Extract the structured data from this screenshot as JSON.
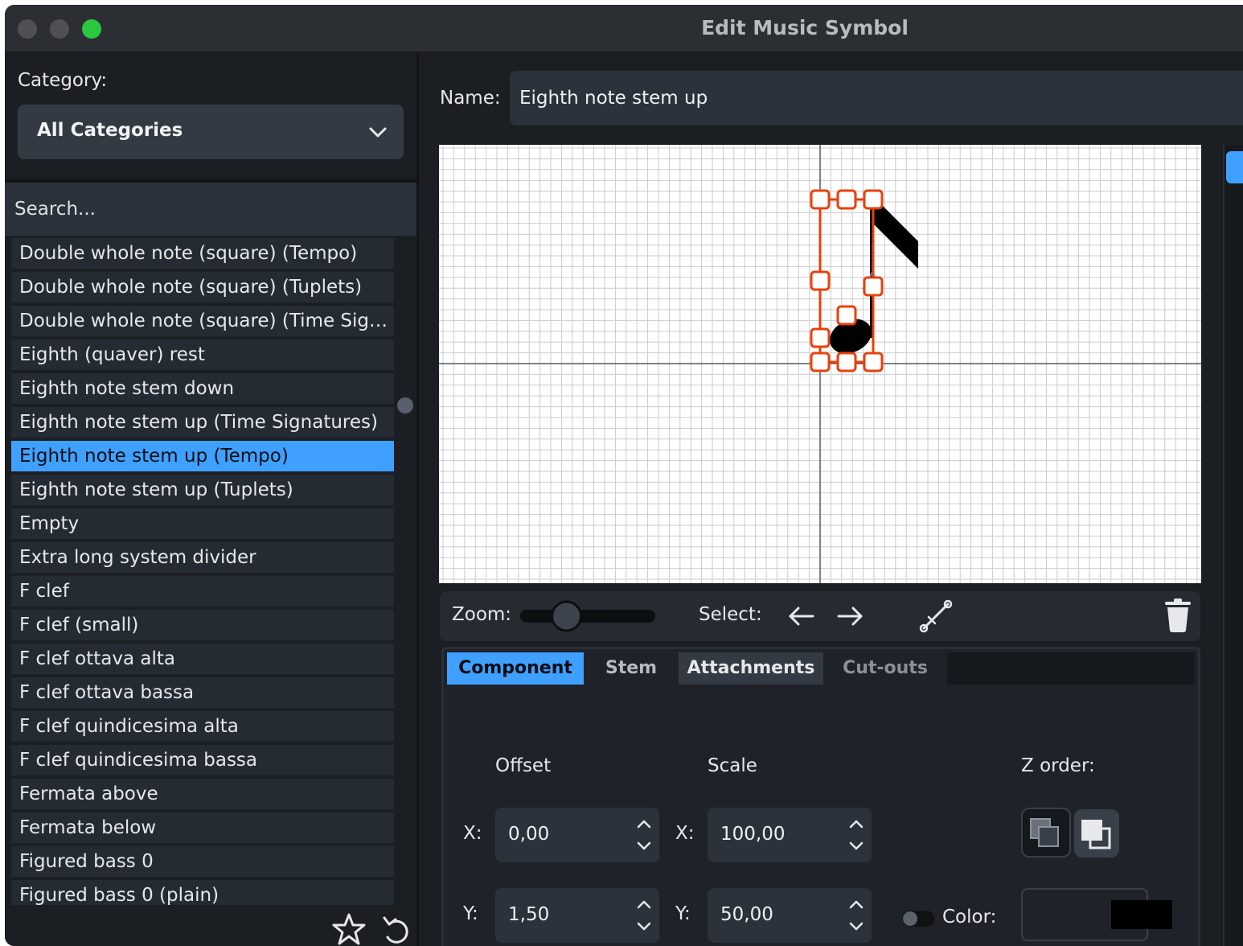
{
  "window": {
    "title": "Edit Music Symbol"
  },
  "category": {
    "label": "Category:",
    "value": "All Categories"
  },
  "search": {
    "placeholder": "Search..."
  },
  "symbols": [
    "Double whole note (square) (Tempo)",
    "Double whole note (square) (Tuplets)",
    "Double whole note (square) (Time Signat…",
    "Eighth (quaver) rest",
    "Eighth note stem down",
    "Eighth note stem up (Time Signatures)",
    "Eighth note stem up (Tempo)",
    "Eighth note stem up (Tuplets)",
    "Empty",
    "Extra long system divider",
    "F clef",
    "F clef (small)",
    "F clef ottava alta",
    "F clef ottava bassa",
    "F clef quindicesima alta",
    "F clef quindicesima bassa",
    "Fermata above",
    "Fermata below",
    "Figured bass 0",
    "Figured bass 0 (plain)"
  ],
  "selected_symbol": "Eighth note stem up (Tempo)",
  "name": {
    "label": "Name:",
    "value": "Eighth note stem up"
  },
  "toolbar": {
    "zoom_label": "Zoom:",
    "zoom_level": 0.3,
    "select_label": "Select:",
    "icons": [
      "arrow-left-icon",
      "arrow-right-icon",
      "curve-edit-icon",
      "trash-icon"
    ]
  },
  "tabs": [
    {
      "label": "Component",
      "state": "active"
    },
    {
      "label": "Stem",
      "state": "inactive"
    },
    {
      "label": "Attachments",
      "state": "highlighted"
    },
    {
      "label": "Cut-outs",
      "state": "disabled"
    }
  ],
  "component": {
    "offset_label": "Offset",
    "scale_label": "Scale",
    "zorder_label": "Z order:",
    "x_label": "X:",
    "y_label": "Y:",
    "offset_x": "0,00",
    "offset_y": "1,50",
    "scale_x": "100,00",
    "scale_y": "50,00",
    "color_label": "Color:",
    "color_value": "#000000"
  },
  "colors": {
    "accent": "#3fa0ff",
    "selection_handles": "#e8400c",
    "window_bg": "#1b1f24"
  }
}
